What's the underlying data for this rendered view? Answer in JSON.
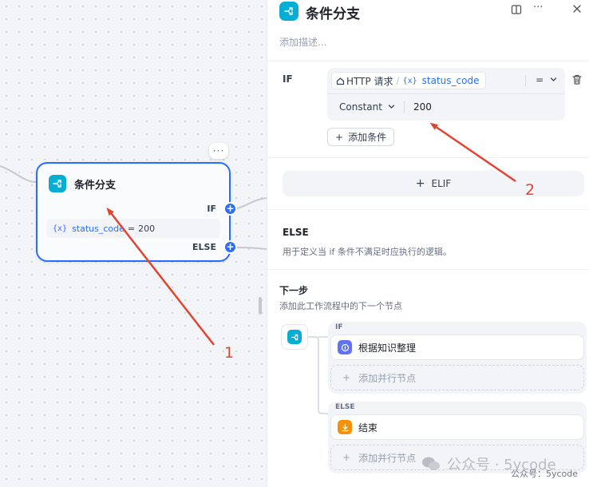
{
  "canvas": {
    "node": {
      "title": "条件分支",
      "if_label": "IF",
      "else_label": "ELSE",
      "condition": {
        "var_icon": "{x}",
        "variable": "status_code",
        "operator": "=",
        "value": "200"
      },
      "menu_label": "···"
    }
  },
  "panel": {
    "title": "条件分支",
    "description_placeholder": "添加描述...",
    "if_label": "IF",
    "condition": {
      "source_node": "HTTP 请求",
      "var_icon": "{x}",
      "variable": "status_code",
      "operator": "=",
      "value_type": "Constant",
      "value": "200"
    },
    "add_condition_label": "添加条件",
    "elif_label": "ELIF",
    "else": {
      "title": "ELSE",
      "description": "用于定义当 if 条件不满足时应执行的逻辑。"
    },
    "next_step": {
      "title": "下一步",
      "description": "添加此工作流程中的下一个节点",
      "branches": [
        {
          "label": "IF",
          "target": "根据知识整理",
          "add_parallel": "添加并行节点"
        },
        {
          "label": "ELSE",
          "target": "结束",
          "add_parallel": "添加并行节点"
        }
      ]
    }
  },
  "annotations": {
    "arrow_1_label": "1",
    "arrow_2_label": "2"
  },
  "watermark": {
    "text": "公众号 · 5ycode",
    "subtext": "公众号：5ycode"
  },
  "colors": {
    "accent": "#296dff",
    "branch_icon": "#06aed4",
    "knowledge_icon": "#6172f3",
    "end_icon": "#f79009",
    "annotation_red": "#e2442f"
  }
}
